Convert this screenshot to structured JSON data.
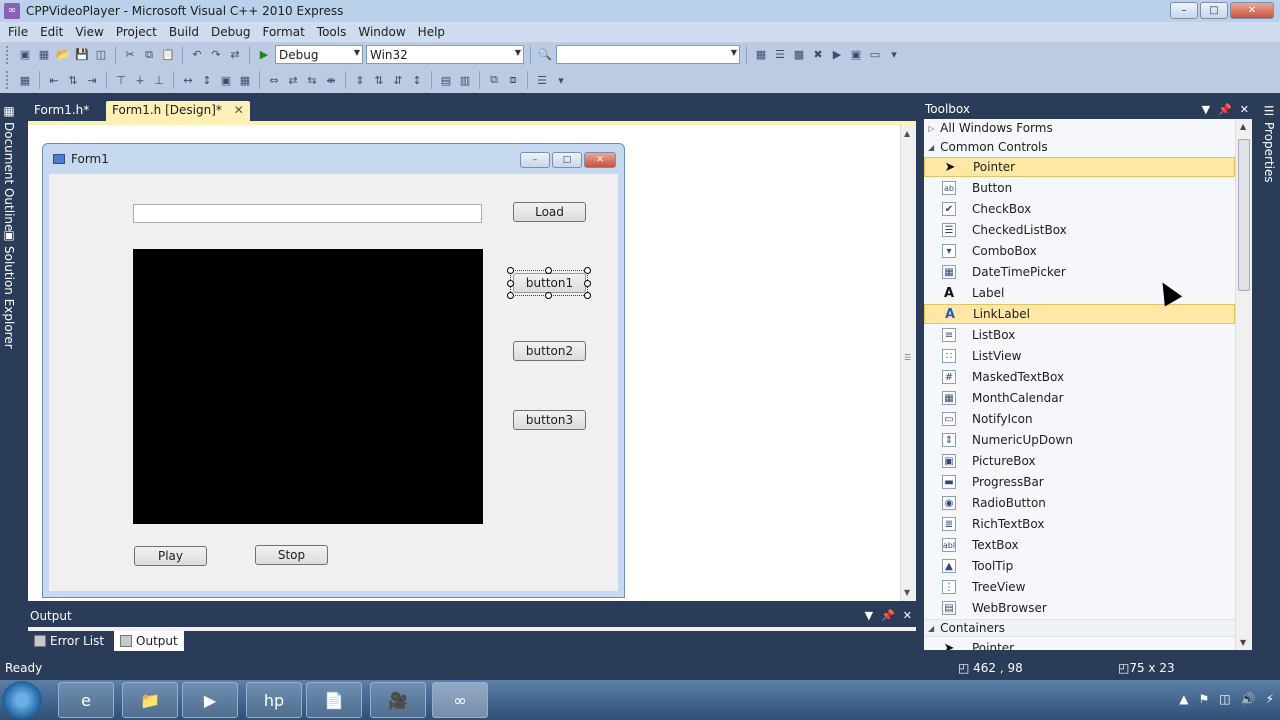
{
  "window": {
    "title": "CPPVideoPlayer - Microsoft Visual C++ 2010 Express",
    "controls": [
      "–",
      "□",
      "✕"
    ]
  },
  "menubar": [
    "File",
    "Edit",
    "View",
    "Project",
    "Build",
    "Debug",
    "Format",
    "Tools",
    "Window",
    "Help"
  ],
  "toolbar": {
    "config": "Debug",
    "platform": "Win32",
    "search": ""
  },
  "leftrail": {
    "document_outline": "Document Outline",
    "solution_explorer": "Solution Explorer"
  },
  "rightrail": {
    "properties": "Properties"
  },
  "doc_tabs": [
    {
      "label": "Form1.h*",
      "active": false
    },
    {
      "label": "Form1.h [Design]*",
      "active": true
    }
  ],
  "form": {
    "title": "Form1",
    "textbox_value": "",
    "buttons": {
      "load": "Load",
      "button1": "button1",
      "button2": "button2",
      "button3": "button3",
      "play": "Play",
      "stop": "Stop"
    }
  },
  "output": {
    "title": "Output",
    "tabs": [
      {
        "label": "Error List",
        "active": false
      },
      {
        "label": "Output",
        "active": true
      }
    ]
  },
  "toolbox": {
    "title": "Toolbox",
    "groups": {
      "all": "All Windows Forms",
      "common": "Common Controls",
      "containers": "Containers"
    },
    "items": [
      {
        "label": "Pointer",
        "icon": "pointer-icon",
        "highlight": true
      },
      {
        "label": "Button",
        "icon": "button-icon",
        "highlight": false
      },
      {
        "label": "CheckBox",
        "icon": "checkbox-icon",
        "highlight": false
      },
      {
        "label": "CheckedListBox",
        "icon": "checkedlistbox-icon",
        "highlight": false
      },
      {
        "label": "ComboBox",
        "icon": "combobox-icon",
        "highlight": false
      },
      {
        "label": "DateTimePicker",
        "icon": "datetimepicker-icon",
        "highlight": false
      },
      {
        "label": "Label",
        "icon": "label-icon",
        "highlight": false
      },
      {
        "label": "LinkLabel",
        "icon": "linklabel-icon",
        "highlight": true
      },
      {
        "label": "ListBox",
        "icon": "listbox-icon",
        "highlight": false
      },
      {
        "label": "ListView",
        "icon": "listview-icon",
        "highlight": false
      },
      {
        "label": "MaskedTextBox",
        "icon": "maskedtextbox-icon",
        "highlight": false
      },
      {
        "label": "MonthCalendar",
        "icon": "monthcalendar-icon",
        "highlight": false
      },
      {
        "label": "NotifyIcon",
        "icon": "notifyicon-icon",
        "highlight": false
      },
      {
        "label": "NumericUpDown",
        "icon": "numericupdown-icon",
        "highlight": false
      },
      {
        "label": "PictureBox",
        "icon": "picturebox-icon",
        "highlight": false
      },
      {
        "label": "ProgressBar",
        "icon": "progressbar-icon",
        "highlight": false
      },
      {
        "label": "RadioButton",
        "icon": "radiobutton-icon",
        "highlight": false
      },
      {
        "label": "RichTextBox",
        "icon": "richtextbox-icon",
        "highlight": false
      },
      {
        "label": "TextBox",
        "icon": "textbox-icon",
        "highlight": false
      },
      {
        "label": "ToolTip",
        "icon": "tooltip-icon",
        "highlight": false
      },
      {
        "label": "TreeView",
        "icon": "treeview-icon",
        "highlight": false
      },
      {
        "label": "WebBrowser",
        "icon": "webbrowser-icon",
        "highlight": false
      }
    ],
    "containers_first": "Pointer"
  },
  "status": {
    "ready": "Ready",
    "position": "462 , 98",
    "size": "75 x 23"
  },
  "colors": {
    "chrome_dark": "#2b3c59",
    "highlight": "#ffe8a6",
    "tab_active": "#fff1b5"
  }
}
